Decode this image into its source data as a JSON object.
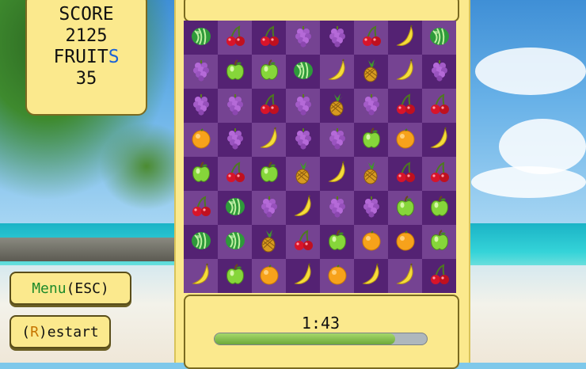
{
  "score_panel": {
    "score_label": "SCORE",
    "score_value": "2125",
    "fruits_label_main": "FRUIT",
    "fruits_label_end": "S",
    "fruits_value": "35"
  },
  "buttons": {
    "menu_before": "Menu",
    "menu_after": " (ESC)",
    "restart_open": "(",
    "restart_key": "R",
    "restart_rest": ")estart"
  },
  "timer": {
    "time": "1:43",
    "progress_fraction": 0.85
  },
  "board": [
    [
      "watermelon",
      "cherry",
      "cherry",
      "grape",
      "grape",
      "cherry",
      "banana",
      "watermelon"
    ],
    [
      "grape",
      "apple",
      "apple",
      "watermelon",
      "banana",
      "pineapple",
      "banana",
      "grape"
    ],
    [
      "grape",
      "grape",
      "cherry",
      "grape",
      "pineapple",
      "grape",
      "cherry",
      "cherry"
    ],
    [
      "orange",
      "grape",
      "banana",
      "grape",
      "grape",
      "apple",
      "orange",
      "banana"
    ],
    [
      "apple",
      "cherry",
      "apple",
      "pineapple",
      "banana",
      "pineapple",
      "cherry",
      "cherry"
    ],
    [
      "cherry",
      "watermelon",
      "grape",
      "banana",
      "grape",
      "grape",
      "apple",
      "apple"
    ],
    [
      "watermelon",
      "watermelon",
      "pineapple",
      "cherry",
      "apple",
      "orange",
      "orange",
      "apple"
    ],
    [
      "banana",
      "apple",
      "orange",
      "banana",
      "orange",
      "banana",
      "banana",
      "cherry"
    ]
  ],
  "colors": {
    "panel": "#fbe98d",
    "board_dark": "#5a2a7a",
    "board_light": "#7a4696",
    "progress_fill": "#8ccc55"
  }
}
